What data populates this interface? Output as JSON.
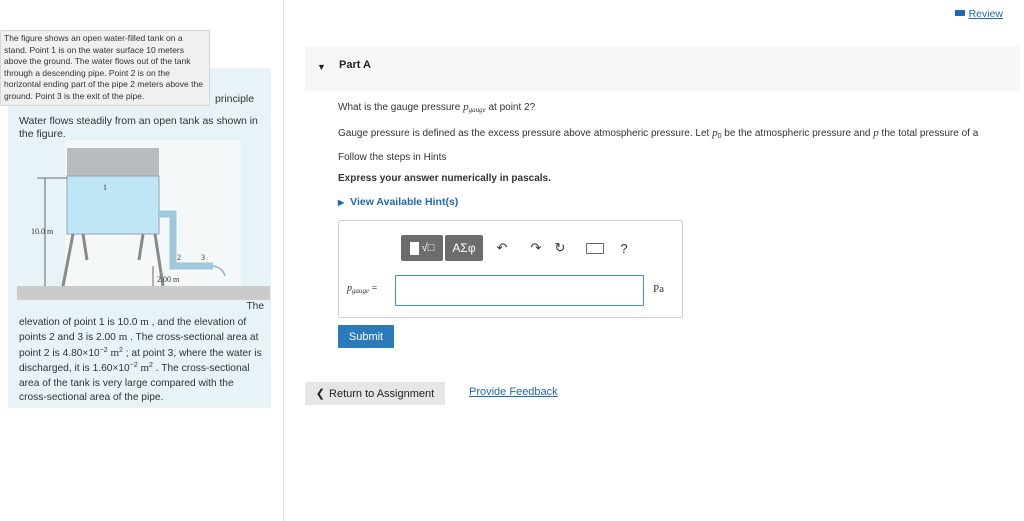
{
  "header": {
    "review_label": "Review"
  },
  "problem": {
    "tooltip_text": "The figure shows an open water-filled tank on a stand. Point 1 is on the water surface 10 meters above the ground. The water flows out of the tank through a descending pipe. Point 2 is on the horizontal ending part of the pipe 2 meters above the ground. Point 3 is the exit of the pipe.",
    "principle_text": "principle",
    "intro": "Water flows steadily from an open tank as shown in the figure.",
    "figure": {
      "height_label": "10.0 m",
      "pipe_label": "2.00 m",
      "point1": "1",
      "point2": "2",
      "point3": "3"
    },
    "desc_the": "The",
    "desc_1": "elevation of point 1 is 10.0 ",
    "desc_m1": "m",
    "desc_2": " , and the elevation of points 2 and 3 is 2.00 ",
    "desc_m2": "m",
    "desc_3": " . The cross-sectional area at point 2 is 4.80×10",
    "desc_exp1": "−2",
    "desc_m3": " m",
    "desc_sq1": "2",
    "desc_4": " ; at point 3, where the water is discharged, it is 1.60×10",
    "desc_exp2": "−2",
    "desc_m4": " m",
    "desc_sq2": "2",
    "desc_5": " . The cross-sectional area of the tank is very large compared with the cross-sectional area of the pipe."
  },
  "part": {
    "title": "Part A",
    "q_prefix": "What is the gauge pressure ",
    "q_var": "p",
    "q_var_sub": "gauge",
    "q_suffix": " at point 2?",
    "def_1": "Gauge pressure is defined as the excess pressure above atmospheric pressure. Let ",
    "def_p0": "p",
    "def_p0_sub": "0",
    "def_2": " be the atmospheric pressure and ",
    "def_p": "p",
    "def_3": " the total pressure of a",
    "follow": "Follow the steps in Hints",
    "express": "Express your answer numerically in pascals.",
    "hint_label": "View Available Hint(s)"
  },
  "answer": {
    "toolbar_greek": "ΑΣφ",
    "help_label": "?",
    "label_var": "p",
    "label_sub": "gauge",
    "label_eq": " =",
    "input_value": "",
    "unit": "Pa"
  },
  "actions": {
    "submit_label": "Submit",
    "return_label": "Return to Assignment",
    "feedback_label": "Provide Feedback"
  }
}
